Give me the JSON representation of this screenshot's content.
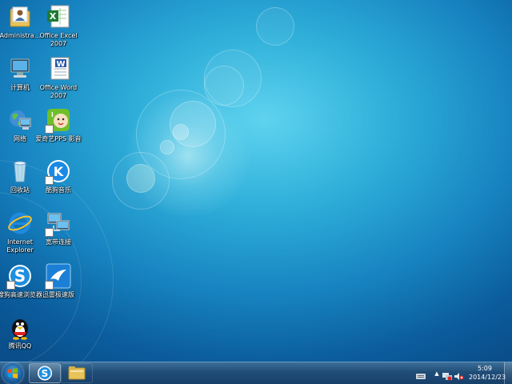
{
  "desktop": {
    "icons": [
      {
        "label": "Administra..."
      },
      {
        "label": "Office Excel 2007"
      },
      {
        "label": "计算机"
      },
      {
        "label": "Office Word 2007"
      },
      {
        "label": "网络"
      },
      {
        "label": "爱奇艺PPS 影音"
      },
      {
        "label": "回收站"
      },
      {
        "label": "酷狗音乐"
      },
      {
        "label": "Internet Explorer"
      },
      {
        "label": "宽带连接"
      },
      {
        "label": "搜狗高速浏览器"
      },
      {
        "label": "迅雷极速版"
      },
      {
        "label": "腾讯QQ"
      }
    ]
  },
  "taskbar": {
    "clock": {
      "time": "5:09",
      "date": "2014/12/23"
    },
    "tray_arrow": "▲"
  }
}
